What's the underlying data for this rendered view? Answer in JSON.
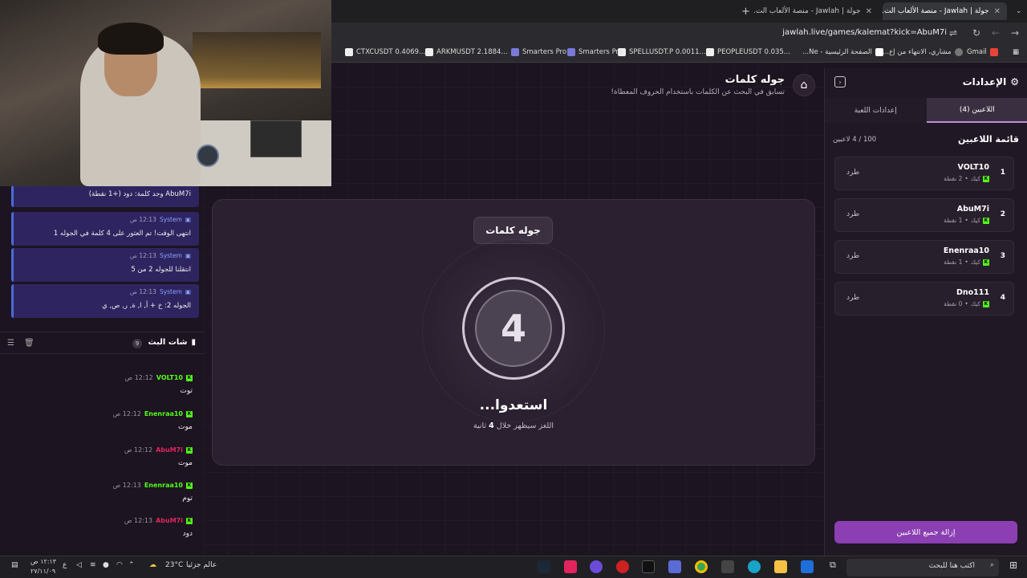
{
  "browser": {
    "tabs": [
      {
        "title": "جولة | Jawlah - منصة الألعاب الت..",
        "active": true
      },
      {
        "title": "جولة | Jawlah - منصة الألعاب الت..",
        "active": false
      }
    ],
    "url": "jawlah.live/games/kalemat?kick=AbuM7i",
    "bookmarks": [
      "Gmail",
      "مشاري، الانتهاء من إع...",
      "الصفحة الرئيسية - Ne...",
      "PEOPLEUSDT 0.035...",
      "SPELLUSDT.P 0.0011...",
      "Smarters Pro",
      "Smarters Pro",
      "ARKMUSDT 2.1884...",
      "CTXCUSDT 0.4069..."
    ]
  },
  "header": {
    "title": "جوله كلمات",
    "subtitle": "تسابق في البحث عن الكلمات باستخدام الحروف المعطاة!"
  },
  "settings": {
    "title": "الإعدادات",
    "tabs": [
      "اللاعبين (4)",
      "إعدادات اللعبة"
    ],
    "list_title": "قائمة اللاعبين",
    "count": "100 / 4 لاعبين",
    "kick_label": "طرد",
    "remove_all": "إزالة جميع اللاعبين",
    "players": [
      {
        "rank": "1",
        "name": "VOLT10",
        "platform": "كيك",
        "points": "2 نقطة"
      },
      {
        "rank": "2",
        "name": "AbuM7i",
        "platform": "كيك",
        "points": "1 نقطة"
      },
      {
        "rank": "3",
        "name": "Enenraa10",
        "platform": "كيك",
        "points": "1 نقطة"
      },
      {
        "rank": "4",
        "name": "Dno111",
        "platform": "كيك",
        "points": "0 نقطة"
      }
    ]
  },
  "game": {
    "pill": "جوله كلمات",
    "countdown": "4",
    "ready": "استعدوا...",
    "hint_pre": "اللغز سيظهر خلال",
    "hint_num": "4",
    "hint_post": "ثانية"
  },
  "system_log": [
    {
      "author": "",
      "time": "",
      "text": "AbuM7i وجد كلمة: دود (+1 نقطة)"
    },
    {
      "author": "System",
      "time": "12:13 ص",
      "text": "انتهى الوقت! تم العثور على 4 كلمة في الجوله 1"
    },
    {
      "author": "System",
      "time": "12:13 ص",
      "text": "انتقلنا للجوله 2 من 5"
    },
    {
      "author": "System",
      "time": "12:13 ص",
      "text": "الجوله 2: خ + أ, ا, ة, ر, ص, ي"
    }
  ],
  "chat": {
    "title": "شات البث",
    "badge": "9",
    "messages": [
      {
        "user": "VOLT10",
        "color": "#53fc18",
        "time": "12:12 ص",
        "text": "توت"
      },
      {
        "user": "Enenraa10",
        "color": "#53fc18",
        "time": "12:12 ص",
        "text": "موت"
      },
      {
        "user": "AbuM7i",
        "color": "#e0245e",
        "time": "12:12 ص",
        "text": "موت"
      },
      {
        "user": "Enenraa10",
        "color": "#53fc18",
        "time": "12:13 ص",
        "text": "توم"
      },
      {
        "user": "AbuM7i",
        "color": "#e0245e",
        "time": "12:13 ص",
        "text": "دود"
      }
    ]
  },
  "taskbar": {
    "search_placeholder": "اكتب هنا للبحث",
    "weather": "23°C",
    "weather_label": "عالم جزئيا",
    "clock_time": "١٢:١٣ ص",
    "clock_date": "٢٧/١١/٠٩",
    "lang": "ع"
  },
  "colors": {
    "accent": "#8b3fb3",
    "kick_green": "#53fc18",
    "system_blue": "#4b6bd8"
  }
}
